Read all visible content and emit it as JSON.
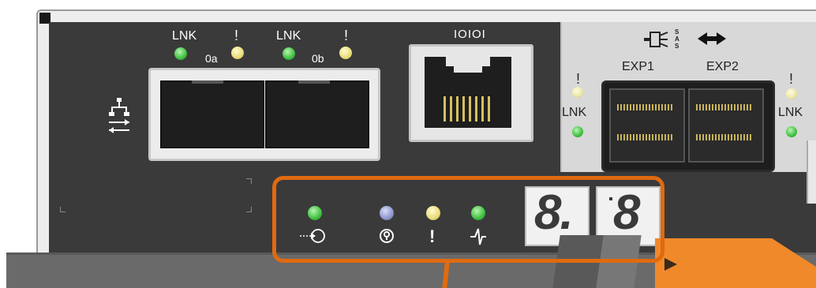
{
  "network": {
    "port_0a": {
      "lnk_label": "LNK",
      "fault_label": "!",
      "port_label": "0a"
    },
    "port_0b": {
      "lnk_label": "LNK",
      "fault_label": "!",
      "port_label": "0b"
    }
  },
  "serial": {
    "label": "IOIOI"
  },
  "sas": {
    "icon_text": "SAS",
    "exp1_label": "EXP1",
    "exp2_label": "EXP2",
    "left_fault": "!",
    "left_lnk": "LNK",
    "right_fault": "!",
    "right_lnk": "LNK"
  },
  "status_leds": {
    "attention_symbol": "!"
  },
  "display": {
    "digit1": "8.",
    "digit2": "8"
  },
  "colors": {
    "panel": "#3a3a3a",
    "sas_panel": "#d8d8d8",
    "highlight": "#e06a10",
    "arrow": "#f0892a",
    "led_green": "#3fc040",
    "led_amber": "#e9dc7a",
    "led_blue": "#8e96cc"
  }
}
